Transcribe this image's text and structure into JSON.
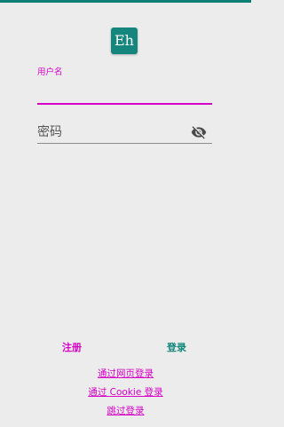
{
  "app": {
    "logo_text": "Eh",
    "accent_color": "#d600c8",
    "primary_color": "#12877c"
  },
  "form": {
    "username_label": "用户名",
    "username_value": "",
    "password_placeholder": "密码",
    "password_toggle_icon": "eye-off-icon"
  },
  "actions": {
    "register_label": "注册",
    "login_label": "登录"
  },
  "links": {
    "web_login": "通过网页登录",
    "cookie_login": "通过 Cookie 登录",
    "skip_login": "跳过登录"
  }
}
